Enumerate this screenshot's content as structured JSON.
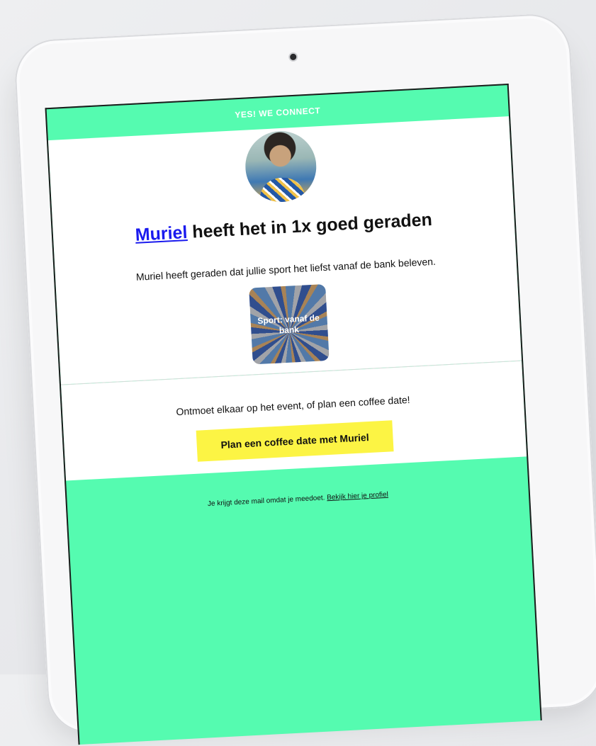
{
  "email": {
    "brand": "YES! WE CONNECT",
    "headline_name": "Muriel",
    "headline_rest": " heeft het in 1x goed geraden",
    "description": "Muriel heeft geraden dat jullie sport het liefst vanaf de bank beleven.",
    "tile_label": "Sport: vanaf de bank",
    "invite_text": "Ontmoet elkaar op het event, of plan een coffee date!",
    "cta_label": "Plan een coffee date met Muriel",
    "footer_text": "Je krijgt deze mail omdat je meedoet. ",
    "footer_link": "Bekijk hier je profiel"
  },
  "colors": {
    "brand_green": "#55fbb0",
    "cta_yellow": "#fcf444",
    "link_blue": "#1a1aee"
  }
}
